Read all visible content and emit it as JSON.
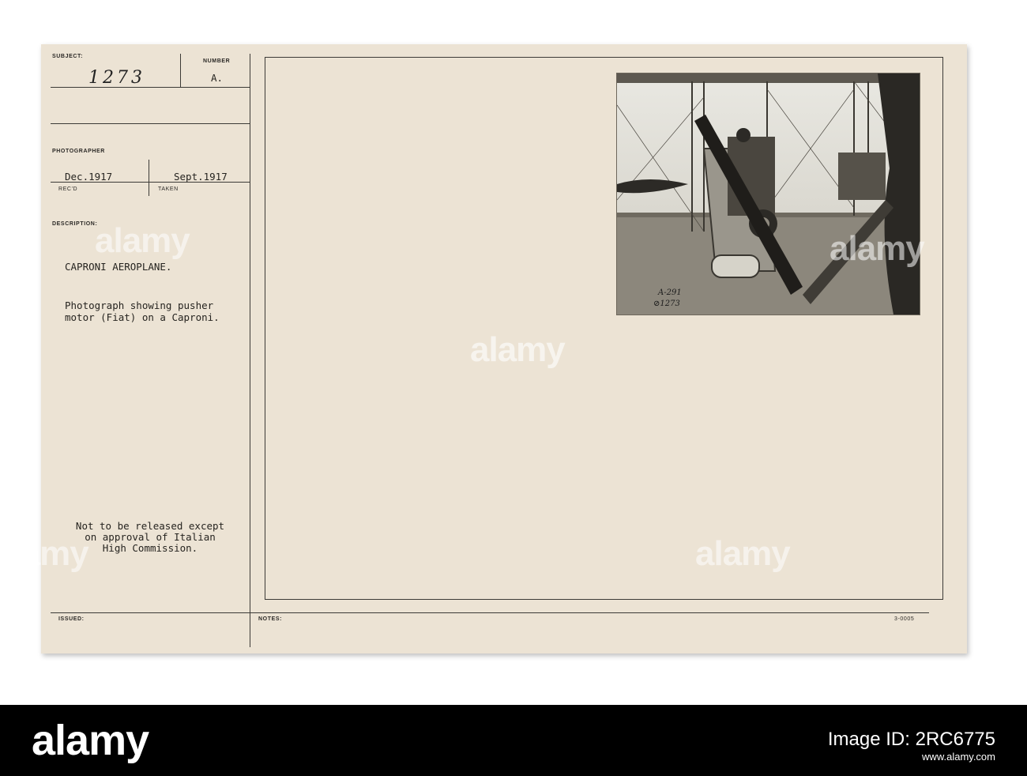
{
  "card": {
    "subject_label": "SUBJECT:",
    "subject_number": "1273",
    "number_label": "NUMBER",
    "number_value": "A.",
    "photographer_label": "PHOTOGRAPHER",
    "received_date": "Dec.1917",
    "received_label": "REC'D",
    "taken_date": "Sept.1917",
    "taken_label": "TAKEN",
    "description_label": "DESCRIPTION:",
    "title": "CAPRONI AEROPLANE.",
    "description_lines": [
      "Photograph showing pusher",
      "motor (Fiat) on a Caproni."
    ],
    "restriction_lines": [
      "Not to be released except",
      "on approval of Italian",
      "High Commission."
    ],
    "issued_label": "ISSUED:",
    "notes_label": "NOTES:",
    "form_code": "3-0005"
  },
  "photo": {
    "marking_1": "A-291",
    "marking_2": "⊘1273"
  },
  "watermark": "alamy",
  "footer": {
    "logo": "alamy",
    "image_id": "Image ID: 2RC6775",
    "url": "www.alamy.com"
  }
}
